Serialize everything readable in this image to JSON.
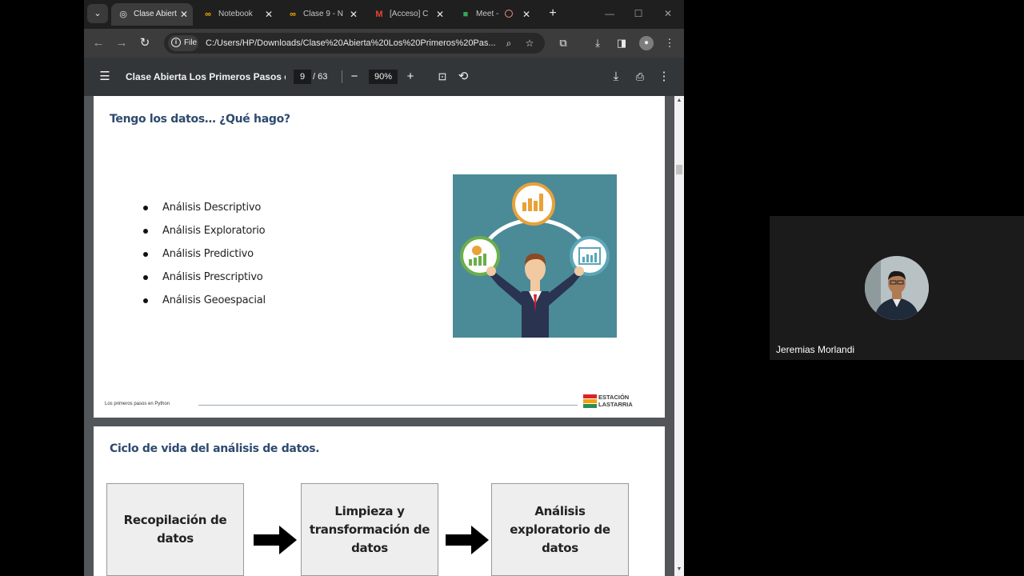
{
  "browser": {
    "tabs": [
      {
        "title": "Clase Abiert",
        "icon": "globe-icon",
        "active": true
      },
      {
        "title": "Notebook",
        "icon": "colab-icon",
        "active": false
      },
      {
        "title": "Clase 9 - N",
        "icon": "colab-icon",
        "active": false
      },
      {
        "title": "[Acceso] C",
        "icon": "gmail-icon",
        "active": false
      },
      {
        "title": "Meet -",
        "icon": "meet-icon",
        "active": false
      }
    ],
    "address": {
      "file_chip": "File",
      "url": "C:/Users/HP/Downloads/Clase%20Abierta%20Los%20Primeros%20Pas..."
    }
  },
  "pdf_toolbar": {
    "title": "Clase Abierta Los Primeros Pasos e...",
    "page_current": "9",
    "page_total": "/ 63",
    "zoom": "90%"
  },
  "slide1": {
    "title": "Tengo los datos… ¿Qué hago?",
    "bullets": [
      "Análisis Descriptivo",
      "Análisis Exploratorio",
      "Análisis Predictivo",
      "Análisis Prescriptivo",
      "Análisis Geoespacial"
    ],
    "footer": "Los primeros pasos en Python",
    "logo_line1": "ESTACIÓN",
    "logo_line2": "LASTARRIA"
  },
  "slide2": {
    "title": "Ciclo de vida del análisis de datos.",
    "steps": [
      [
        "Recopilación de",
        "datos"
      ],
      [
        "Limpieza y",
        "transformación de",
        "datos"
      ],
      [
        "Análisis",
        "exploratorio de",
        "datos"
      ]
    ]
  },
  "participant": {
    "name": "Jeremias Morlandi"
  },
  "colors": {
    "tab_bg": "#1f1f1f",
    "toolbar_bg": "#3c3c3c",
    "pdf_toolbar_bg": "#323639",
    "viewer_bg": "#525659",
    "slide_title": "#2e4a6e",
    "illustration_bg": "#4a8b97",
    "chart_orange": "#e8a238"
  }
}
